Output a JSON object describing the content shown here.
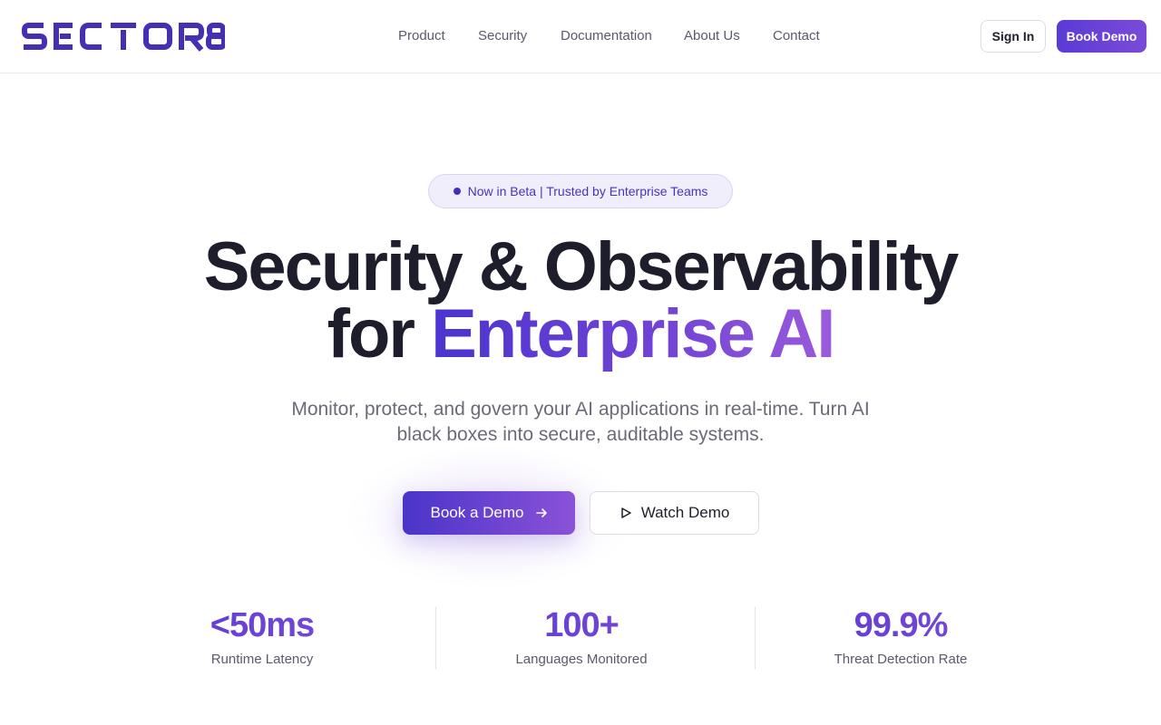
{
  "brand": {
    "logo_text": "SECTOR8",
    "color": "#4330b5"
  },
  "nav": {
    "items": [
      "Product",
      "Security",
      "Documentation",
      "About Us",
      "Contact"
    ],
    "sign_in": "Sign In",
    "book_demo": "Book Demo"
  },
  "hero": {
    "badge": "Now in Beta | Trusted by Enterprise Teams",
    "headline_line1": "Security & Observability",
    "headline_line2_prefix": "for",
    "headline_line2_accent": "Enterprise AI",
    "subtitle": "Monitor, protect, and govern your AI applications in real-time. Turn AI black boxes into secure, auditable systems.",
    "cta_primary": "Book a Demo",
    "cta_secondary": "Watch Demo"
  },
  "stats": [
    {
      "value": "<50ms",
      "label": "Runtime Latency"
    },
    {
      "value": "100+",
      "label": "Languages Monitored"
    },
    {
      "value": "99.9%",
      "label": "Threat Detection Rate"
    }
  ],
  "colors": {
    "accent_start": "#4a34cf",
    "accent_end": "#9b5bdb",
    "badge_bg": "#f1eefc",
    "text_dark": "#1d1d2b",
    "text_muted": "#6b6b78"
  },
  "icons": {
    "cta_primary": "arrow-right-icon",
    "cta_secondary": "play-icon",
    "badge": "status-dot-icon"
  }
}
